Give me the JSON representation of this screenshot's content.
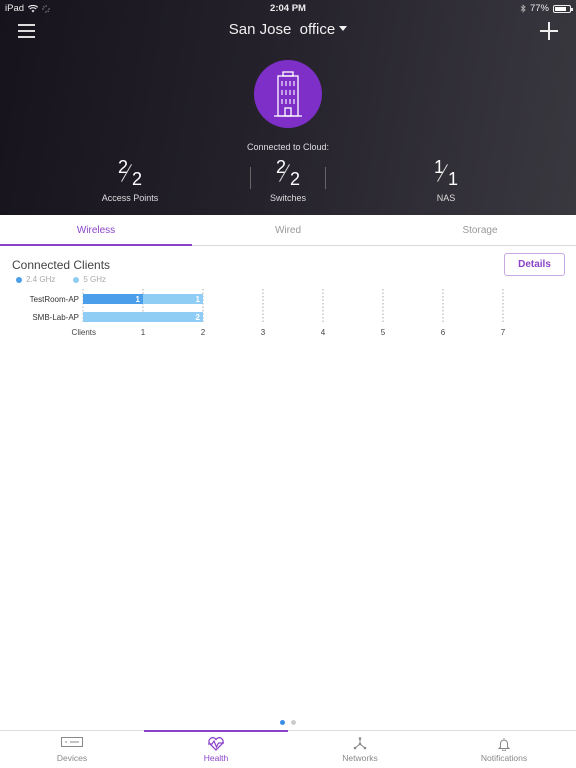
{
  "status_bar": {
    "device": "iPad",
    "time": "2:04 PM",
    "battery_percent": "77%",
    "battery_level": 0.77
  },
  "header": {
    "site_name": "San Jose  office",
    "menu_icon": "hamburger-menu-icon",
    "add_icon": "plus-icon",
    "site_icon": "office-building-icon"
  },
  "cloud": {
    "label": "Connected to Cloud:",
    "stats": [
      {
        "connected": "2",
        "total": "2",
        "label": "Access Points"
      },
      {
        "connected": "2",
        "total": "2",
        "label": "Switches"
      },
      {
        "connected": "1",
        "total": "1",
        "label": "NAS"
      }
    ]
  },
  "tabs": [
    {
      "label": "Wireless",
      "active": true
    },
    {
      "label": "Wired",
      "active": false
    },
    {
      "label": "Storage",
      "active": false
    }
  ],
  "section": {
    "title": "Connected Clients",
    "details_label": "Details"
  },
  "chart_data": {
    "type": "bar",
    "orientation": "horizontal",
    "stacked": true,
    "title": "Connected Clients",
    "xlabel": "Clients",
    "categories": [
      "TestRoom-AP",
      "SMB-Lab-AP"
    ],
    "series": [
      {
        "name": "2.4 GHz",
        "color": "#4a9eea",
        "values": [
          1,
          0
        ]
      },
      {
        "name": "5 GHz",
        "color": "#8fcdf5",
        "values": [
          1,
          2
        ]
      }
    ],
    "x_ticks": [
      1,
      2,
      3,
      4,
      5,
      6,
      7
    ],
    "xlim": [
      0,
      7
    ],
    "grid": "vertical-dotted",
    "legend": "top-left"
  },
  "pager": {
    "pages": 2,
    "current": 0
  },
  "tabbar": [
    {
      "label": "Devices",
      "icon": "device-icon",
      "active": false
    },
    {
      "label": "Health",
      "icon": "heart-pulse-icon",
      "active": true
    },
    {
      "label": "Networks",
      "icon": "network-topology-icon",
      "active": false
    },
    {
      "label": "Notifications",
      "icon": "bell-icon",
      "active": false
    }
  ],
  "colors": {
    "accent": "#8b44c9",
    "site_icon_bg": "#7d2fc7",
    "bar_24ghz": "#4a9eea",
    "bar_5ghz": "#8fcdf5"
  }
}
